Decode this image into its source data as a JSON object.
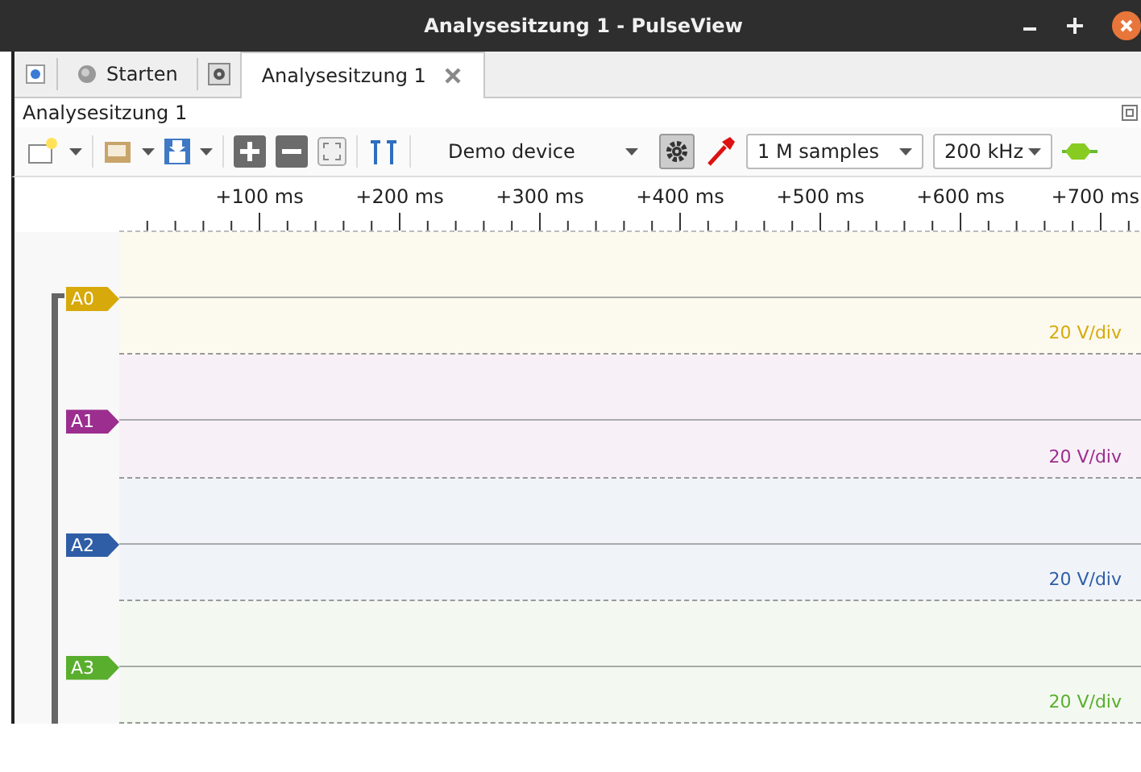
{
  "window": {
    "title": "Analysesitzung 1 - PulseView"
  },
  "tabs": [
    {
      "kind": "start",
      "label": "Starten",
      "selected": false
    },
    {
      "kind": "session",
      "label": "Analysesitzung 1",
      "selected": true
    }
  ],
  "session_title": "Analysesitzung 1",
  "toolbar": {
    "device": "Demo device",
    "samples": "1 M samples",
    "samplerate": "200 kHz"
  },
  "ruler": [
    "+100 ms",
    "+200 ms",
    "+300 ms",
    "+400 ms",
    "+500 ms",
    "+600 ms",
    "+700 ms"
  ],
  "channels": [
    {
      "name": "A0",
      "color": "#d7a90a",
      "scale": "20 V/div"
    },
    {
      "name": "A1",
      "color": "#9b2e8e",
      "scale": "20 V/div"
    },
    {
      "name": "A2",
      "color": "#2f5ea6",
      "scale": "20 V/div"
    },
    {
      "name": "A3",
      "color": "#5aae2e",
      "scale": "20 V/div"
    }
  ]
}
